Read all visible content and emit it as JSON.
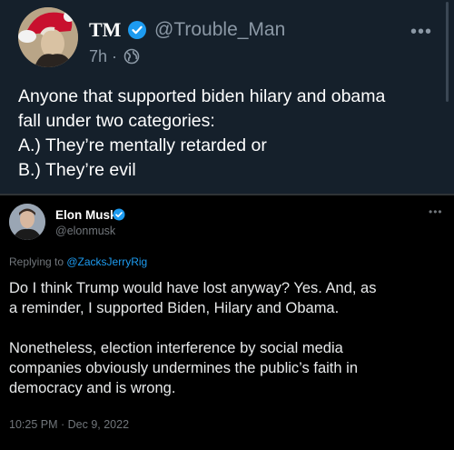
{
  "top_tweet": {
    "display_name": "TM",
    "handle": "@Trouble_Man",
    "time": "7h ·",
    "more": "•••",
    "lines": [
      "Anyone that supported biden hilary and obama",
      "fall under two categories:",
      "A.) They’re mentally retarded or",
      "B.) They’re evil"
    ]
  },
  "quoted_tweet": {
    "display_name": "Elon Musk",
    "handle": "@elonmusk",
    "more": "•••",
    "replying_prefix": "Replying to ",
    "replying_mention": "@ZacksJerryRig",
    "paragraph1": [
      "Do I think Trump would have lost anyway? Yes. And, as",
      "a reminder, I supported Biden, Hilary and Obama."
    ],
    "paragraph2": [
      "Nonetheless, election interference by social media",
      "companies obviously undermines the public’s faith in",
      "democracy and is wrong."
    ],
    "timestamp": "10:25 PM · Dec 9, 2022"
  },
  "colors": {
    "top_background": "#15202b",
    "bottom_background": "#000000",
    "verified_blue": "#1d9bf0",
    "muted_text": "#8b98a5"
  },
  "icons": [
    "verified-badge-icon",
    "globe-icon",
    "more-options-icon"
  ]
}
